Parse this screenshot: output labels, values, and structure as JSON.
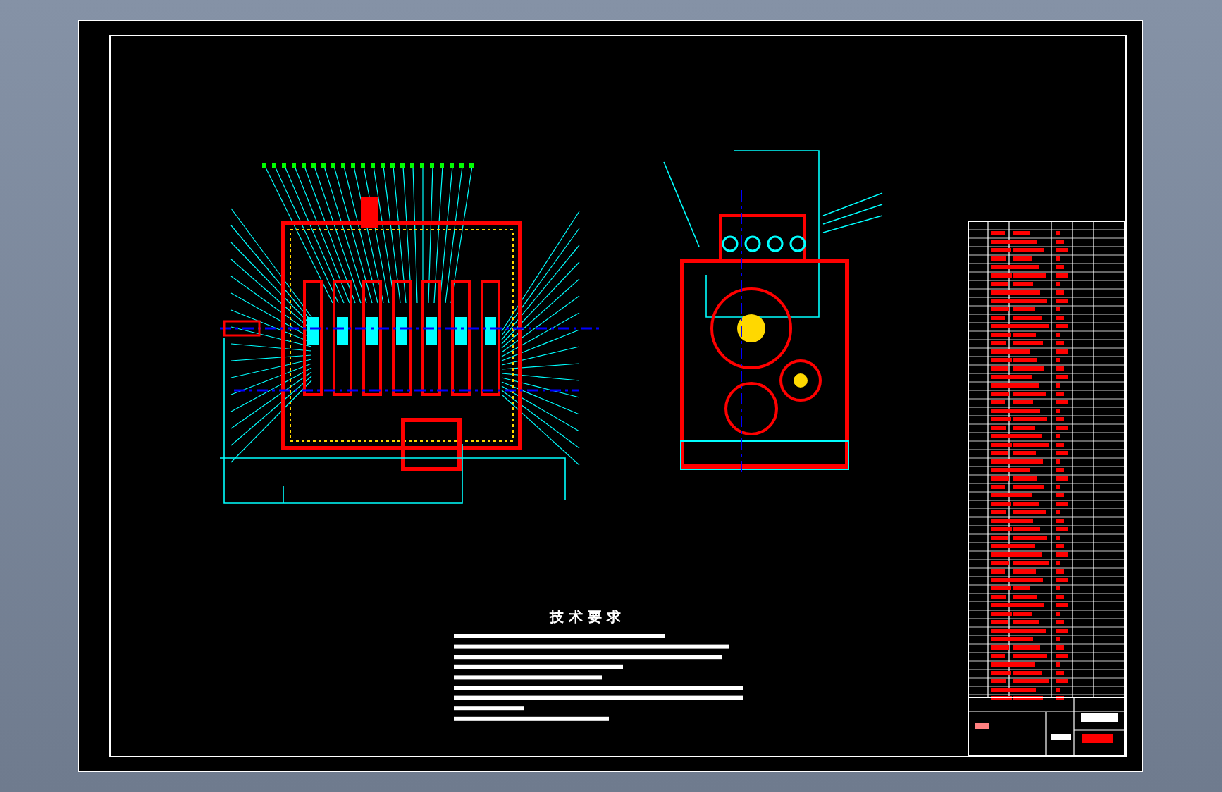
{
  "drawing": {
    "notes_title": "技 术 要 求"
  }
}
